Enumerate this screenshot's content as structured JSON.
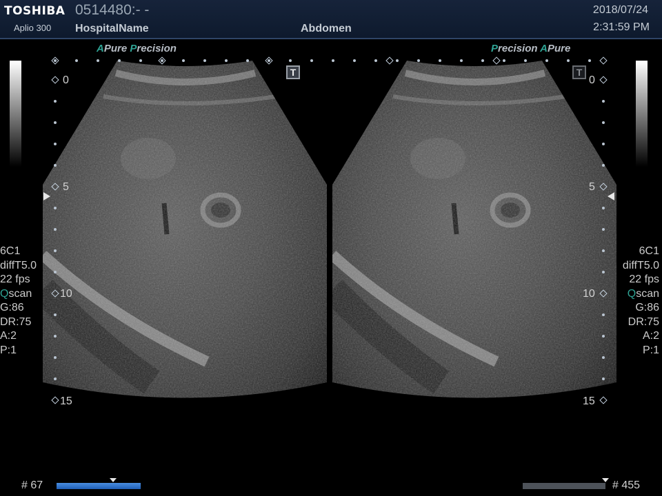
{
  "header": {
    "brand": "TOSHIBA",
    "model": "Aplio 300",
    "patient_id": "0514480:- -",
    "hospital": "HospitalName",
    "exam": "Abdomen",
    "date": "2018/07/24",
    "time": "2:31:59 PM"
  },
  "left_panel": {
    "tags": [
      {
        "k": "A",
        "t": "Pure"
      },
      {
        "k": "P",
        "t": "recision"
      }
    ],
    "t_marker": "T",
    "depth_labels": [
      "0",
      "5",
      "10",
      "15"
    ],
    "params": {
      "probe": "6C1",
      "mode": "diffT5.0",
      "fps": "22 fps",
      "q": "Q",
      "scan": "scan",
      "gain": "G:86",
      "dr": "DR:75",
      "a": "A:2",
      "p": "P:1"
    },
    "frame_label": "# 67",
    "frame_progress": 0.67
  },
  "right_panel": {
    "tags": [
      {
        "k": "P",
        "t": "recision"
      },
      {
        "k": "A",
        "t": "Pure"
      }
    ],
    "t_marker": "T",
    "depth_labels": [
      "0",
      "5",
      "10",
      "15"
    ],
    "params": {
      "probe": "6C1",
      "mode": "diffT5.0",
      "fps": "22 fps",
      "q": "Q",
      "scan": "scan",
      "gain": "G:86",
      "dr": "DR:75",
      "a": "A:2",
      "p": "P:1"
    },
    "frame_label": "# 455",
    "frame_progress": 1.0
  },
  "colors": {
    "accent": "#2fa394",
    "header_bg": "#16233a",
    "progress_blue": "#1f5fb8"
  }
}
